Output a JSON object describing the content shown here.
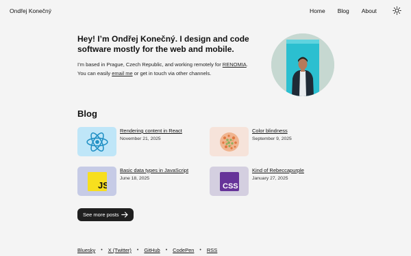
{
  "header": {
    "site_title": "Ondřej Konečný",
    "nav": [
      "Home",
      "Blog",
      "About"
    ],
    "theme_toggle_icon": "sun-icon"
  },
  "hero": {
    "heading": "Hey! I’m Ondřej Konečný. I design and code software mostly for the web and mobile.",
    "line1_before": "I’m based in Prague, Czech Republic, and working remotely for ",
    "company_link": "RENOMIA",
    "line1_after": ".",
    "line2_before": "You can easily ",
    "email_link": "email me",
    "line2_after": " or get in touch via other channels."
  },
  "blog": {
    "heading": "Blog",
    "posts": [
      {
        "title": "Rendering content in React",
        "date": "November 21, 2025",
        "icon": "react-icon",
        "thumb_color": "#bfe6f8"
      },
      {
        "title": "Color blindness",
        "date": "September 9, 2025",
        "icon": "ishihara-icon",
        "thumb_color": "#f6e3da"
      },
      {
        "title": "Basic data types in JavaScript",
        "date": "June 18, 2025",
        "icon": "javascript-icon",
        "thumb_color": "#c6cbe6"
      },
      {
        "title": "Kind of Rebeccapurple",
        "date": "January 27, 2025",
        "icon": "css-icon",
        "thumb_color": "#d4cfe0"
      }
    ],
    "more_button": "See more posts"
  },
  "footer": {
    "links": [
      "Bluesky",
      "X (Twitter)",
      "GitHub",
      "CodePen",
      "RSS"
    ],
    "separator": "•"
  },
  "colors": {
    "background": "#f4f4f4",
    "button": "#1f1f1f",
    "react": "#1f8fc4",
    "js": "#f7df1e",
    "css": "#663399"
  }
}
